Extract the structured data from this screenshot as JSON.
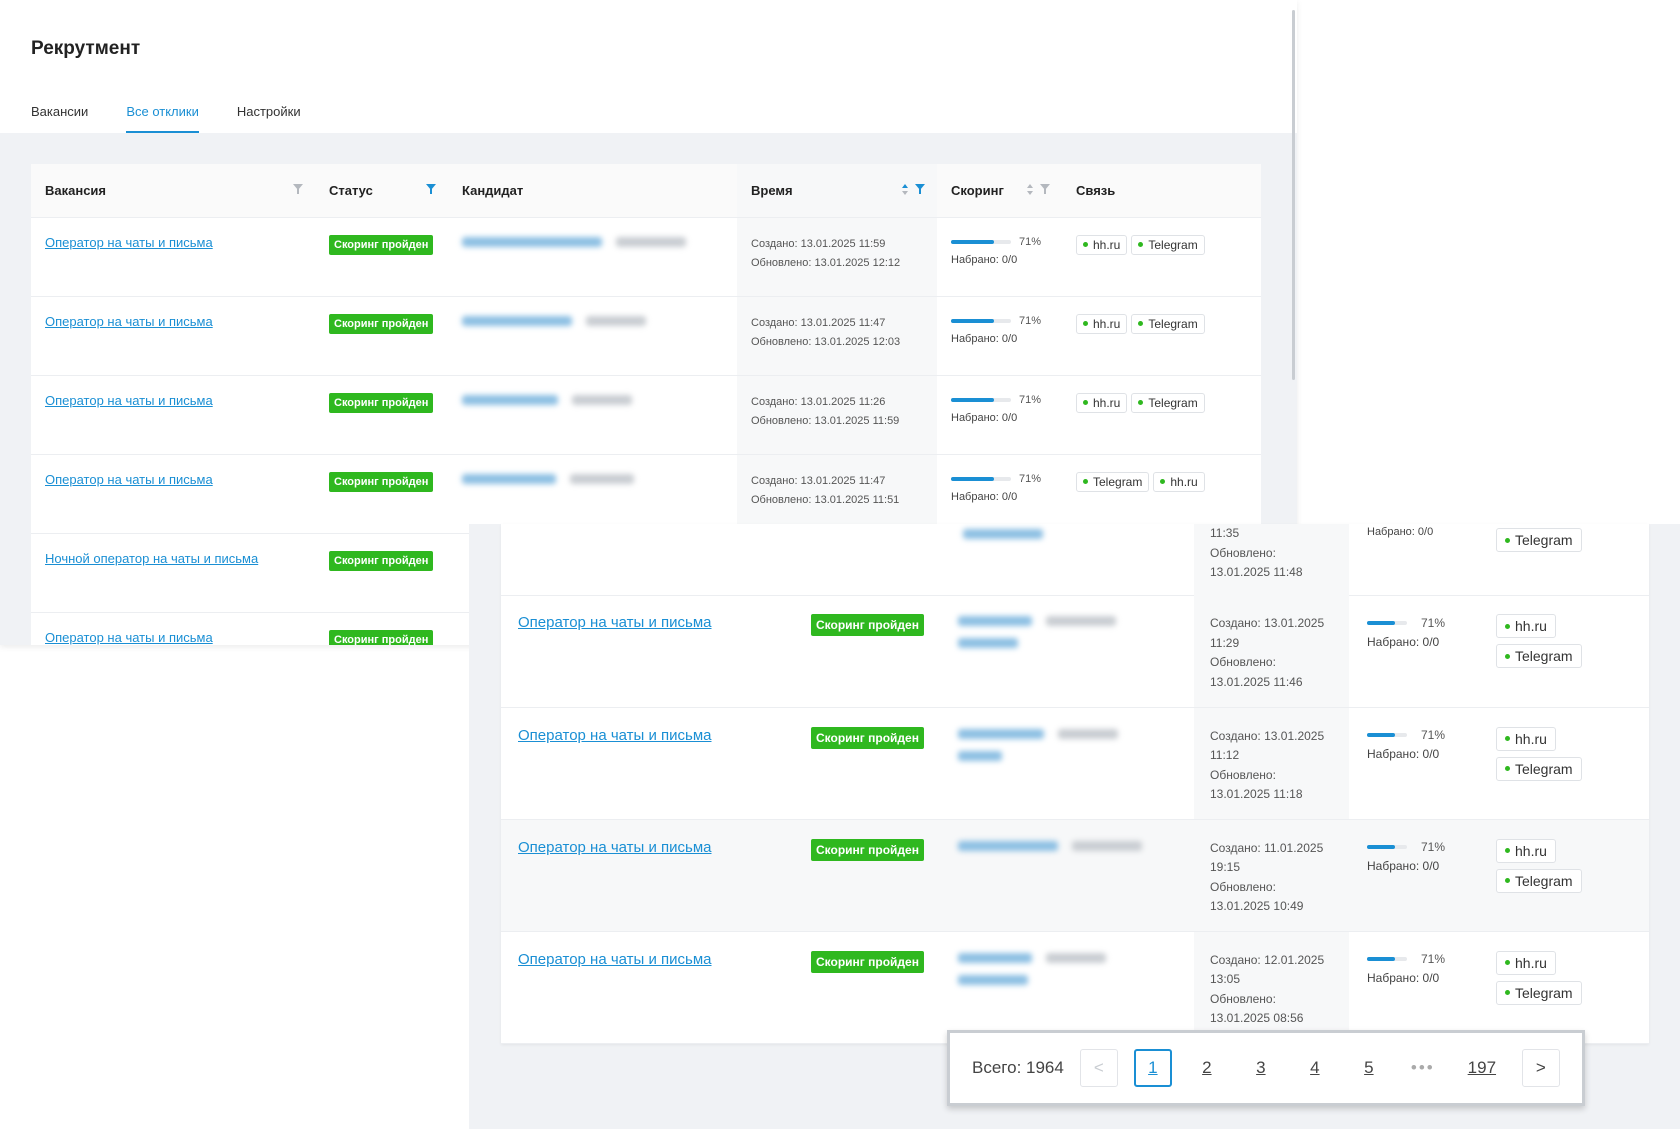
{
  "app": {
    "title": "Рекрутмент"
  },
  "tabs": [
    {
      "label": "Вакансии"
    },
    {
      "label": "Все отклики"
    },
    {
      "label": "Настройки"
    }
  ],
  "table": {
    "columns": [
      "Вакансия",
      "Статус",
      "Кандидат",
      "Время",
      "Скоринг",
      "Связь"
    ],
    "rows": [
      {
        "vacancy": "Оператор на чаты и письма",
        "status": "Скоринг пройден",
        "created": "Создано: 13.01.2025 11:59",
        "updated": "Обновлено: 13.01.2025 12:12",
        "score_pct": 71,
        "score_label": "71%",
        "collected": "Набрано: 0/0",
        "contacts": [
          "hh.ru",
          "Telegram"
        ]
      },
      {
        "vacancy": "Оператор на чаты и письма",
        "status": "Скоринг пройден",
        "created": "Создано: 13.01.2025 11:47",
        "updated": "Обновлено: 13.01.2025 12:03",
        "score_pct": 71,
        "score_label": "71%",
        "collected": "Набрано: 0/0",
        "contacts": [
          "hh.ru",
          "Telegram"
        ]
      },
      {
        "vacancy": "Оператор на чаты и письма",
        "status": "Скоринг пройден",
        "created": "Создано: 13.01.2025 11:26",
        "updated": "Обновлено: 13.01.2025 11:59",
        "score_pct": 71,
        "score_label": "71%",
        "collected": "Набрано: 0/0",
        "contacts": [
          "hh.ru",
          "Telegram"
        ]
      },
      {
        "vacancy": "Оператор на чаты и письма",
        "status": "Скоринг пройден",
        "created": "Создано: 13.01.2025 11:47",
        "updated": "Обновлено: 13.01.2025 11:51",
        "score_pct": 71,
        "score_label": "71%",
        "collected": "Набрано: 0/0",
        "contacts": [
          "Telegram",
          "hh.ru"
        ]
      },
      {
        "vacancy": "Ночной оператор на чаты и письма",
        "status": "Скоринг пройден"
      },
      {
        "vacancy": "Оператор на чаты и письма",
        "status": "Скоринг пройден"
      }
    ]
  },
  "table2": {
    "first_row": {
      "time_top": "11:35",
      "updated_label": "Обновлено:",
      "updated_date": "13.01.2025 11:48",
      "collected": "Набрано: 0/0",
      "contact": "Telegram"
    },
    "rows": [
      {
        "vacancy": "Оператор на чаты и письма",
        "status": "Скоринг пройден",
        "created": "Создано: 13.01.2025",
        "created_time": "11:29",
        "updated_label": "Обновлено:",
        "updated": "13.01.2025 11:46",
        "score_pct": 71,
        "score_label": "71%",
        "collected": "Набрано: 0/0",
        "contacts": [
          "hh.ru",
          "Telegram"
        ]
      },
      {
        "vacancy": "Оператор на чаты и письма",
        "status": "Скоринг пройден",
        "created": "Создано: 13.01.2025",
        "created_time": "11:12",
        "updated_label": "Обновлено:",
        "updated": "13.01.2025 11:18",
        "score_pct": 71,
        "score_label": "71%",
        "collected": "Набрано: 0/0",
        "contacts": [
          "hh.ru",
          "Telegram"
        ]
      },
      {
        "vacancy": "Оператор на чаты и письма",
        "status": "Скоринг пройден",
        "created": "Создано: 11.01.2025",
        "created_time": "19:15",
        "updated_label": "Обновлено:",
        "updated": "13.01.2025 10:49",
        "score_pct": 71,
        "score_label": "71%",
        "collected": "Набрано: 0/0",
        "contacts": [
          "hh.ru",
          "Telegram"
        ]
      },
      {
        "vacancy": "Оператор на чаты и письма",
        "status": "Скоринг пройден",
        "created": "Создано: 12.01.2025",
        "created_time": "13:05",
        "updated_label": "Обновлено:",
        "updated": "13.01.2025 08:56",
        "score_pct": 71,
        "score_label": "71%",
        "collected": "Набрано: 0/0",
        "contacts": [
          "hh.ru",
          "Telegram"
        ]
      }
    ]
  },
  "pagination": {
    "total": "Всего: 1964",
    "prev": "<",
    "next": ">",
    "pages": [
      "1",
      "2",
      "3",
      "4",
      "5"
    ],
    "ellipsis": "•••",
    "last": "197",
    "current": "1"
  },
  "colors": {
    "accent": "#1a8fd4",
    "success": "#2fb81f"
  }
}
